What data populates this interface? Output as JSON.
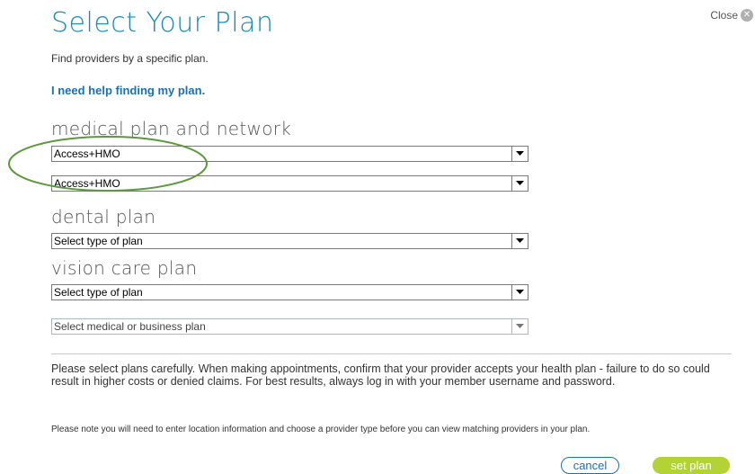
{
  "dialog": {
    "title": "Select Your Plan",
    "close_label": "Close",
    "close_icon": "x-icon",
    "subtitle": "Find providers by a specific plan.",
    "help_link": "I need help finding my plan."
  },
  "medical": {
    "label": "medical plan and network",
    "plan_value": "Access+HMO",
    "network_value": "Access+HMO"
  },
  "dental": {
    "label": "dental plan",
    "value": "Select type of plan"
  },
  "vision": {
    "label": "vision care plan",
    "value": "Select type of plan",
    "secondary_value": "Select medical or business plan"
  },
  "notice": {
    "main": "Please select plans carefully. When making appointments, confirm that your provider accepts your health plan - failure to do so could result in higher costs or denied claims. For best results, always log in with your member username and password.",
    "small": "Please note you will need to enter location information and choose a provider type before you can view matching providers in your plan."
  },
  "buttons": {
    "cancel": "cancel",
    "set_plan": "set plan"
  },
  "colors": {
    "title": "#1a8ab5",
    "link": "#1a6fb5",
    "set_plan_button": "#b2d235",
    "highlight_ellipse": "#5a9a3c"
  }
}
